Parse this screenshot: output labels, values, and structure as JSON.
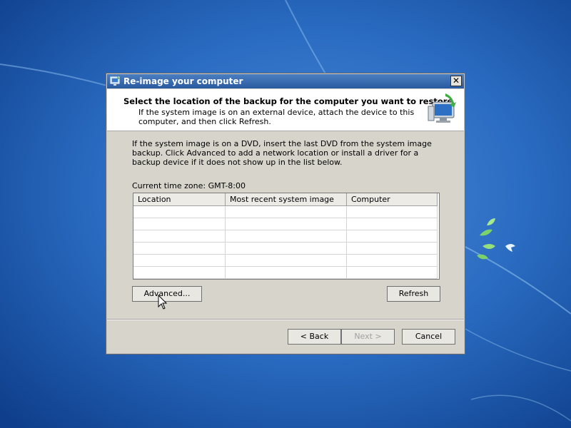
{
  "dialog": {
    "title": "Re-image your computer",
    "close_label": "✕",
    "header": {
      "title": "Select the location of the backup for the computer you want to restore",
      "subtitle": "If the system image is on an external device, attach the device to this computer, and then click Refresh."
    },
    "info_text": "If the system image is on a DVD, insert the last DVD from the system image backup. Click Advanced to add a network location or install a driver for a backup device if it does not show up in the list below.",
    "timezone_label": "Current time zone: GMT-8:00",
    "table": {
      "columns": [
        "Location",
        "Most recent system image",
        "Computer"
      ],
      "rows": [
        [
          "",
          "",
          ""
        ],
        [
          "",
          "",
          ""
        ],
        [
          "",
          "",
          ""
        ],
        [
          "",
          "",
          ""
        ],
        [
          "",
          "",
          ""
        ],
        [
          "",
          "",
          ""
        ]
      ]
    },
    "buttons": {
      "advanced": "Advanced...",
      "refresh": "Refresh",
      "back": "< Back",
      "next": "Next >",
      "cancel": "Cancel"
    }
  },
  "colors": {
    "desktop_bg": "#1f62b6",
    "titlebar": "#2a5aa0",
    "dialog_bg": "#d7d4cc",
    "header_bg": "#ffffff"
  },
  "icons": {
    "title_icon": "backup-restore-icon",
    "header_icon": "computer-restore-icon",
    "cursor": "mouse-pointer-icon"
  }
}
